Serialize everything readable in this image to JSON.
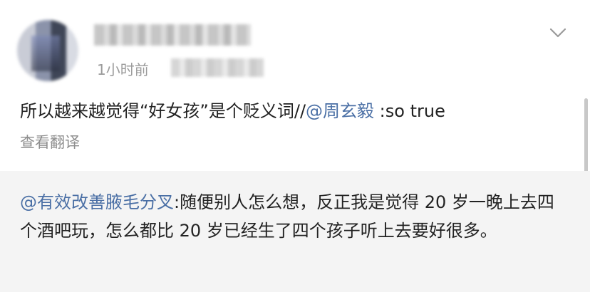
{
  "post": {
    "time": "1小时前",
    "text_prefix": "所以越来越觉得“好女孩”是个贬义词//",
    "mention": "@周玄毅",
    "text_suffix": " :so true",
    "translate_label": "查看翻译"
  },
  "repost": {
    "mention": "@有效改善腋毛分叉",
    "text": ":随便别人怎么想，反正我是觉得 20 岁一晚上去四个酒吧玩，怎么都比 20 岁已经生了四个孩子听上去要好很多。"
  },
  "icons": {
    "menu": "chevron-down-icon"
  }
}
